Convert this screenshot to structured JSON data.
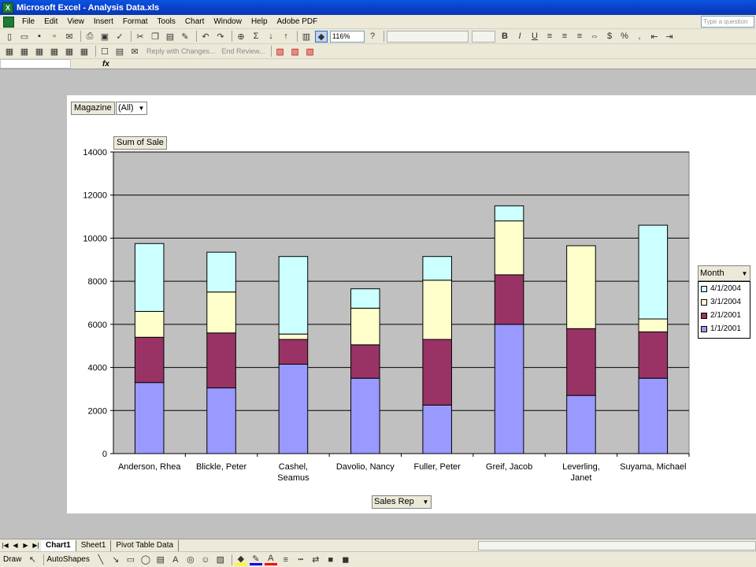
{
  "window": {
    "title": "Microsoft Excel - Analysis Data.xls",
    "app_icon": "excel-icon"
  },
  "menu": {
    "items": [
      "File",
      "Edit",
      "View",
      "Insert",
      "Format",
      "Tools",
      "Chart",
      "Window",
      "Help",
      "Adobe PDF"
    ],
    "help_placeholder": "Type a question"
  },
  "toolbar": {
    "zoom": "116%",
    "reply_label": "Reply with Changes...",
    "end_review_label": "End Review...",
    "formula_fx": "fx"
  },
  "pivot": {
    "page_field_label": "Magazine",
    "page_field_value": "(All)",
    "data_field_label": "Sum of Sale",
    "category_field_label": "Sales Rep",
    "series_field_label": "Month"
  },
  "chart_data": {
    "type": "bar",
    "stacked": true,
    "categories": [
      "Anderson, Rhea",
      "Blickle, Peter",
      "Cashel, Seamus",
      "Davolio, Nancy",
      "Fuller, Peter",
      "Greif, Jacob",
      "Leverling, Janet",
      "Suyama, Michael"
    ],
    "series": [
      {
        "name": "1/1/2001",
        "color": "#9999FF",
        "values": [
          3300,
          3050,
          4150,
          3500,
          2250,
          6000,
          2700,
          3500
        ]
      },
      {
        "name": "2/1/2001",
        "color": "#993366",
        "values": [
          2100,
          2550,
          1150,
          1550,
          3050,
          2300,
          3100,
          2150
        ]
      },
      {
        "name": "3/1/2004",
        "color": "#FFFFCC",
        "values": [
          1200,
          1900,
          250,
          1700,
          2750,
          2500,
          3850,
          600
        ]
      },
      {
        "name": "4/1/2004",
        "color": "#CCFFFF",
        "values": [
          3150,
          1850,
          3600,
          900,
          1100,
          700,
          0,
          4350
        ]
      }
    ],
    "ylim": [
      0,
      14000
    ],
    "yticks": [
      0,
      2000,
      4000,
      6000,
      8000,
      10000,
      12000,
      14000
    ],
    "plot_background": "#C0C0C0",
    "grid": true,
    "legend_placement": "right"
  },
  "sheet_tabs": [
    "Chart1",
    "Sheet1",
    "Pivot Table Data"
  ],
  "drawing": {
    "draw_label": "Draw",
    "autoshapes_label": "AutoShapes"
  }
}
